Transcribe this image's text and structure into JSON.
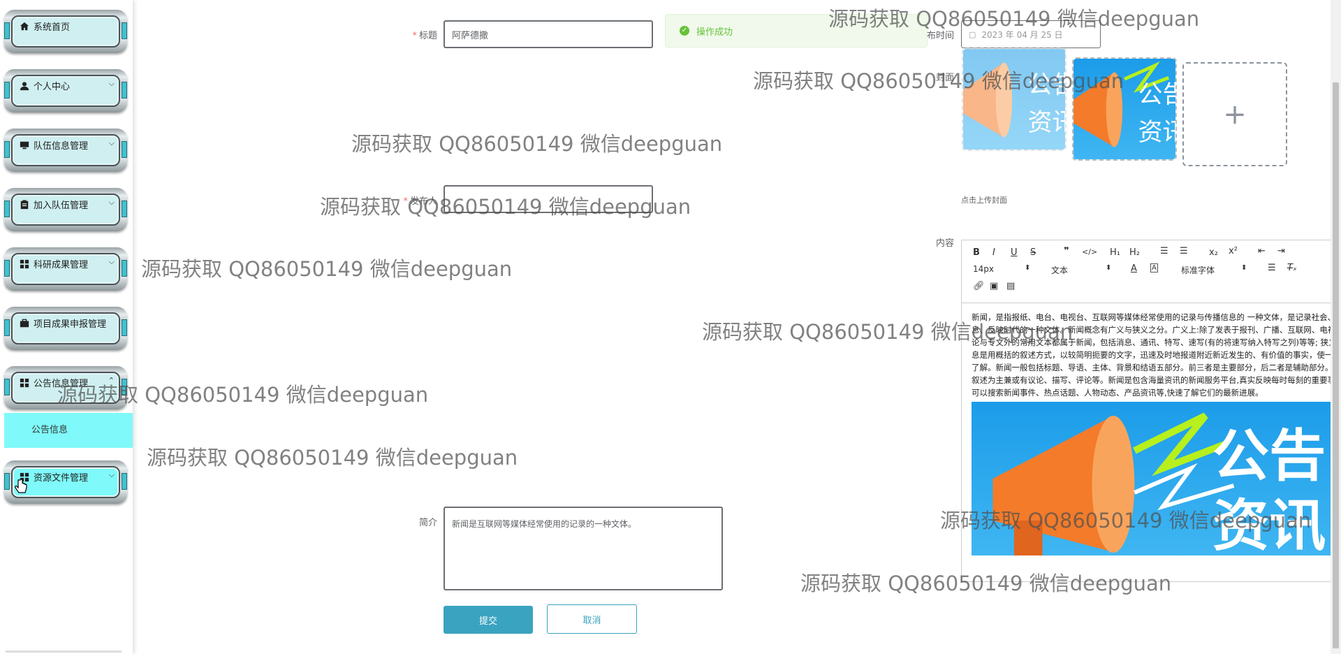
{
  "sidebar": {
    "items": [
      {
        "label": "系统首页",
        "icon": "home-icon",
        "chevron": false
      },
      {
        "label": "个人中心",
        "icon": "user-icon",
        "chevron": true
      },
      {
        "label": "队伍信息管理",
        "icon": "monitor-icon",
        "chevron": true
      },
      {
        "label": "加入队伍管理",
        "icon": "clipboard-icon",
        "chevron": true
      },
      {
        "label": "科研成果管理",
        "icon": "grid-icon",
        "chevron": true
      },
      {
        "label": "项目成果申报管理",
        "icon": "briefcase-icon",
        "chevron": false
      },
      {
        "label": "公告信息管理",
        "icon": "grid-icon",
        "chevron": true
      },
      {
        "label": "资源文件管理",
        "icon": "grid-icon",
        "chevron": true
      }
    ],
    "sub_item": "公告信息"
  },
  "form": {
    "title_label": "标题",
    "title_value": "阿萨德撒",
    "time_label": "布时间",
    "time_value": "2023 年 04 月 25 日",
    "cover_label": "封面",
    "cover_hint": "点击上传封面",
    "publisher_label": "发布人",
    "content_label": "内容",
    "intro_label": "简介",
    "intro_value": "新闻是互联网等媒体经常使用的记录的一种文体。"
  },
  "toast": {
    "message": "操作成功"
  },
  "editor": {
    "font_size": "14px",
    "paragraph": "文本",
    "font_family": "标准字体",
    "content": "新闻，是指报纸、电台、电视台、互联网等媒体经常使用的记录与传播信息的 一种文体，是记录社会、传播信息、反映时代的一种文体。新闻概念有广义与狭义之分。广义上:除了发表于报刊、广播、互联网、电视上的评论与专文外的常用文本都属于新闻，包括消息、通讯、特写、速写(有的将速写纳入特写之列)等等; 狭义上:消息是用概括的叙述方式，以较简明扼要的文字，迅速及时地报道附近新近发生的、有价值的事实，使一定人群了解。新闻一般包括标题、导语、主体、背景和结语五部分。前三者是主要部分，后二者是辅助部分。写法以叙述为主兼或有议论、描写、评论等。新闻是包含海量资讯的新闻服务平台,真实反映每时每刻的重要事件。您可以搜索新闻事件、热点话题、人物动态、产品资讯等,快速了解它们的最新进展。",
    "poster_text_1": "公告",
    "poster_text_2": "资讯"
  },
  "buttons": {
    "submit": "提交",
    "cancel": "取消"
  },
  "watermark": "源码获取 QQ86050149 微信deepguan",
  "colors": {
    "accent": "#3aa3c0",
    "menu_active": "#7ff9f9",
    "success": "#67c23a"
  }
}
